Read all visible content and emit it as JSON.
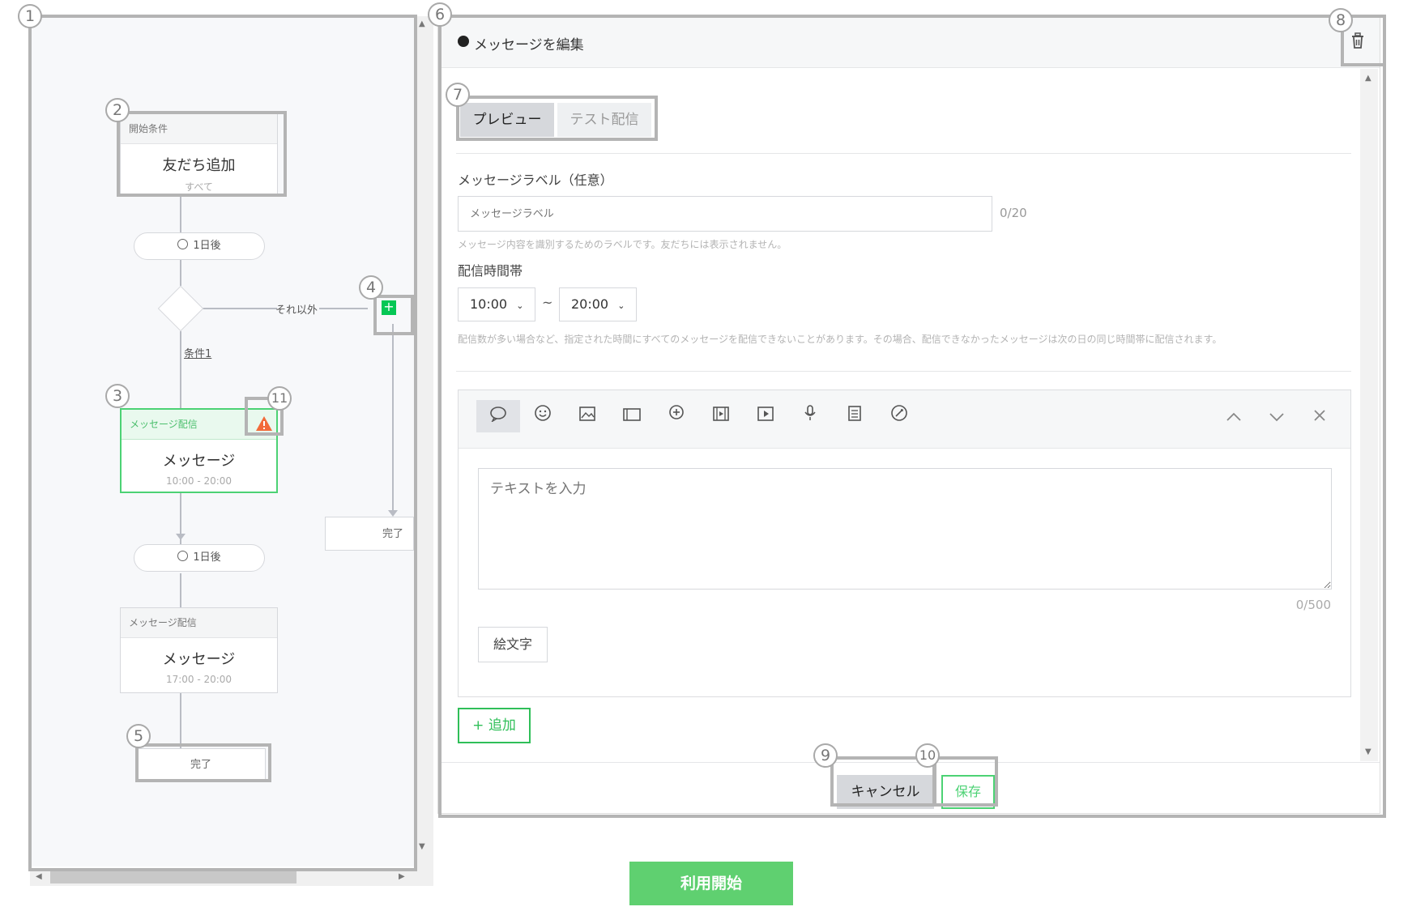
{
  "flow": {
    "start_node": {
      "header": "開始条件",
      "title": "友だち追加",
      "subtitle": "すべて"
    },
    "wait1": "1日後",
    "branch_else": "それ以外",
    "branch_condition": "条件1",
    "msg_node1": {
      "header": "メッセージ配信",
      "title": "メッセージ",
      "time": "10:00 - 20:00"
    },
    "wait2": "1日後",
    "msg_node2": {
      "header": "メッセージ配信",
      "title": "メッセージ",
      "time": "17:00 - 20:00"
    },
    "end_right": "完了",
    "end_bottom": "完了"
  },
  "panel": {
    "title": "メッセージを編集",
    "tabs": {
      "preview": "プレビュー",
      "test": "テスト配信"
    },
    "label_field": {
      "label": "メッセージラベル（任意）",
      "placeholder": "メッセージラベル",
      "counter": "0/20",
      "help": "メッセージ内容を識別するためのラベルです。友だちには表示されません。"
    },
    "delivery": {
      "label": "配信時間帯",
      "start": "10:00",
      "tilde": "~",
      "end": "20:00",
      "help": "配信数が多い場合など、指定された時間にすべてのメッセージを配信できないことがあります。その場合、配信できなかったメッセージは次の日の同じ時間帯に配信されます。"
    },
    "text_area": {
      "placeholder": "テキストを入力",
      "counter": "0/500"
    },
    "emoji_button": "絵文字",
    "add_button": "+ 追加",
    "cancel_button": "キャンセル",
    "save_button": "保存"
  },
  "start_button": "利用開始",
  "annotations": [
    "1",
    "2",
    "3",
    "4",
    "5",
    "6",
    "7",
    "8",
    "9",
    "10",
    "11"
  ],
  "colors": {
    "green": "#06c755",
    "green_light": "#4cd274",
    "warning": "#f26b3a"
  }
}
